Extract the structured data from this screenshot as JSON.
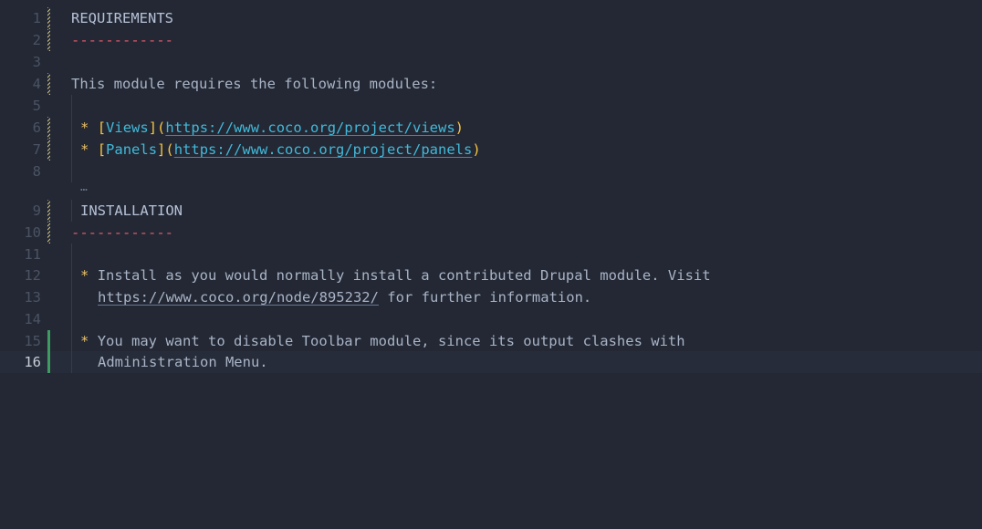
{
  "editor": {
    "lines": [
      {
        "num": "1",
        "heading": "REQUIREMENTS"
      },
      {
        "num": "2",
        "rule": "------------"
      },
      {
        "num": "3"
      },
      {
        "num": "4",
        "text": "This module requires the following modules:"
      },
      {
        "num": "5"
      },
      {
        "num": "6",
        "bullet": "*",
        "link_open": "[",
        "link_text": "Views",
        "link_close": "]",
        "paren_open": "(",
        "url": "https://www.coco.org/project/views",
        "paren_close": ")"
      },
      {
        "num": "7",
        "bullet": "*",
        "link_open": "[",
        "link_text": "Panels",
        "link_close": "]",
        "paren_open": "(",
        "url": "https://www.coco.org/project/panels",
        "paren_close": ")"
      },
      {
        "num": "8"
      },
      {
        "num": "9",
        "heading": "INSTALLATION"
      },
      {
        "num": "10",
        "rule": "------------"
      },
      {
        "num": "11"
      },
      {
        "num": "12",
        "bullet": "*",
        "text": "Install as you would normally install a contributed Drupal module. Visit"
      },
      {
        "num": "13",
        "url": "https://www.coco.org/node/895232/",
        "text": " for further information."
      },
      {
        "num": "14"
      },
      {
        "num": "15",
        "bullet": "*",
        "text": "You may want to disable Toolbar module, since its output clashes with"
      },
      {
        "num": "16",
        "text": "Administration Menu."
      }
    ],
    "fold_marker": "…",
    "current_line": "16"
  },
  "colors": {
    "background": "#232834",
    "heading": "#b6c1d6",
    "rule": "#e05a6b",
    "bullet": "#e8c06a",
    "link": "#42b9d9",
    "gutter_modified": "#c9bf86",
    "gutter_added": "#3e9b62"
  }
}
